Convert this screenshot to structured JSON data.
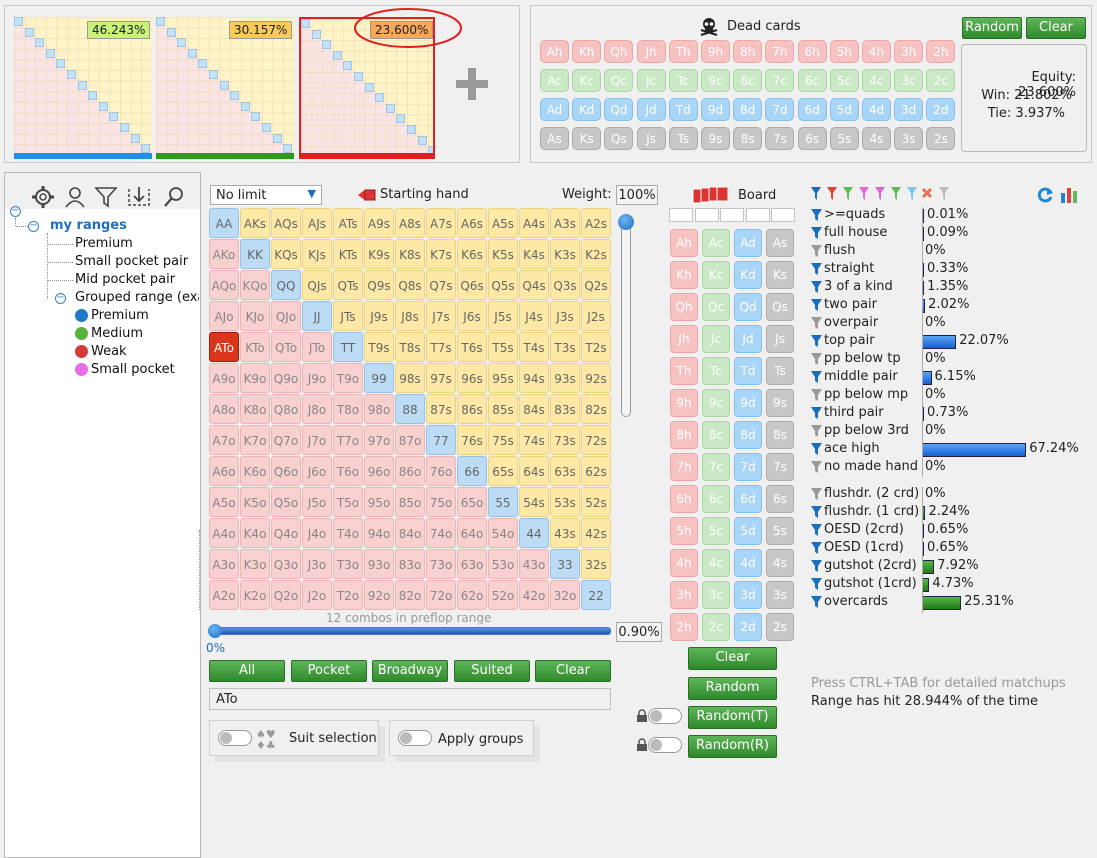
{
  "ranges_top": {
    "mini1_pct": "46.243%",
    "mini2_pct": "30.157%",
    "mini3_pct": "23.600%"
  },
  "dead_cards": {
    "title": "Dead cards",
    "rows": [
      [
        "Ah",
        "Kh",
        "Qh",
        "Jh",
        "Th",
        "9h",
        "8h",
        "7h",
        "6h",
        "5h",
        "4h",
        "3h",
        "2h"
      ],
      [
        "Ac",
        "Kc",
        "Qc",
        "Jc",
        "Tc",
        "9c",
        "8c",
        "7c",
        "6c",
        "5c",
        "4c",
        "3c",
        "2c"
      ],
      [
        "Ad",
        "Kd",
        "Qd",
        "Jd",
        "Td",
        "9d",
        "8d",
        "7d",
        "6d",
        "5d",
        "4d",
        "3d",
        "2d"
      ],
      [
        "As",
        "Ks",
        "Qs",
        "Js",
        "Ts",
        "9s",
        "8s",
        "7s",
        "6s",
        "5s",
        "4s",
        "3s",
        "2s"
      ]
    ],
    "random_label": "Random",
    "clear_label": "Clear"
  },
  "equity": {
    "equity": "Equity: 23.600%",
    "win": "Win: 21.802%",
    "tie": "Tie: 3.937%"
  },
  "tree": {
    "root": "my ranges",
    "items": [
      "Premium",
      "Small pocket pair",
      "Mid pocket pair"
    ],
    "group": "Grouped range (exar",
    "group_items": [
      "Premium",
      "Medium",
      "Weak",
      "Small pocket"
    ],
    "group_colors": [
      "#1f79c9",
      "#58b33c",
      "#d43a3a",
      "#e86be8"
    ]
  },
  "hand_panel": {
    "limit_value": "No limit",
    "starting_hand_label": "Starting hand",
    "weight_label": "Weight:",
    "weight_value": "100%",
    "grid": [
      [
        "AA",
        "AKs",
        "AQs",
        "AJs",
        "ATs",
        "A9s",
        "A8s",
        "A7s",
        "A6s",
        "A5s",
        "A4s",
        "A3s",
        "A2s"
      ],
      [
        "AKo",
        "KK",
        "KQs",
        "KJs",
        "KTs",
        "K9s",
        "K8s",
        "K7s",
        "K6s",
        "K5s",
        "K4s",
        "K3s",
        "K2s"
      ],
      [
        "AQo",
        "KQo",
        "QQ",
        "QJs",
        "QTs",
        "Q9s",
        "Q8s",
        "Q7s",
        "Q6s",
        "Q5s",
        "Q4s",
        "Q3s",
        "Q2s"
      ],
      [
        "AJo",
        "KJo",
        "QJo",
        "JJ",
        "JTs",
        "J9s",
        "J8s",
        "J7s",
        "J6s",
        "J5s",
        "J4s",
        "J3s",
        "J2s"
      ],
      [
        "ATo",
        "KTo",
        "QTo",
        "JTo",
        "TT",
        "T9s",
        "T8s",
        "T7s",
        "T6s",
        "T5s",
        "T4s",
        "T3s",
        "T2s"
      ],
      [
        "A9o",
        "K9o",
        "Q9o",
        "J9o",
        "T9o",
        "99",
        "98s",
        "97s",
        "96s",
        "95s",
        "94s",
        "93s",
        "92s"
      ],
      [
        "A8o",
        "K8o",
        "Q8o",
        "J8o",
        "T8o",
        "98o",
        "88",
        "87s",
        "86s",
        "85s",
        "84s",
        "83s",
        "82s"
      ],
      [
        "A7o",
        "K7o",
        "Q7o",
        "J7o",
        "T7o",
        "97o",
        "87o",
        "77",
        "76s",
        "75s",
        "74s",
        "73s",
        "72s"
      ],
      [
        "A6o",
        "K6o",
        "Q6o",
        "J6o",
        "T6o",
        "96o",
        "86o",
        "76o",
        "66",
        "65s",
        "64s",
        "63s",
        "62s"
      ],
      [
        "A5o",
        "K5o",
        "Q5o",
        "J5o",
        "T5o",
        "95o",
        "85o",
        "75o",
        "65o",
        "55",
        "54s",
        "53s",
        "52s"
      ],
      [
        "A4o",
        "K4o",
        "Q4o",
        "J4o",
        "T4o",
        "94o",
        "84o",
        "74o",
        "64o",
        "54o",
        "44",
        "43s",
        "42s"
      ],
      [
        "A3o",
        "K3o",
        "Q3o",
        "J3o",
        "T3o",
        "93o",
        "83o",
        "73o",
        "63o",
        "53o",
        "43o",
        "33",
        "32s"
      ],
      [
        "A2o",
        "K2o",
        "Q2o",
        "J2o",
        "T2o",
        "92o",
        "82o",
        "72o",
        "62o",
        "52o",
        "42o",
        "32o",
        "22"
      ]
    ],
    "selected": "ATo",
    "combos_text": "12 combos in preflop range",
    "slider_pct": "0.90%",
    "slider_left": "0%",
    "buttons": [
      "All",
      "Pocket",
      "Broadway",
      "Suited",
      "Clear"
    ],
    "range_text": "ATo",
    "suit_selection": "Suit selection",
    "apply_groups": "Apply groups"
  },
  "board": {
    "title": "Board",
    "ranks": [
      "A",
      "K",
      "Q",
      "J",
      "T",
      "9",
      "8",
      "7",
      "6",
      "5",
      "4",
      "3",
      "2"
    ],
    "suits": [
      "h",
      "c",
      "d",
      "s"
    ],
    "clear": "Clear",
    "random": "Random",
    "random_t": "Random(T)",
    "random_r": "Random(R)"
  },
  "stats": {
    "made": [
      {
        "label": ">=quads",
        "value": "0.01%",
        "pct": 0.01
      },
      {
        "label": "full house",
        "value": "0.09%",
        "pct": 0.09
      },
      {
        "label": "flush",
        "value": "0%",
        "pct": 0
      },
      {
        "label": "straight",
        "value": "0.33%",
        "pct": 0.33
      },
      {
        "label": "3 of a kind",
        "value": "1.35%",
        "pct": 1.35
      },
      {
        "label": "two pair",
        "value": "2.02%",
        "pct": 2.02
      },
      {
        "label": "overpair",
        "value": "0%",
        "pct": 0
      },
      {
        "label": "top pair",
        "value": "22.07%",
        "pct": 22.07
      },
      {
        "label": "pp below tp",
        "value": "0%",
        "pct": 0
      },
      {
        "label": "middle pair",
        "value": "6.15%",
        "pct": 6.15
      },
      {
        "label": "pp below mp",
        "value": "0%",
        "pct": 0
      },
      {
        "label": "third pair",
        "value": "0.73%",
        "pct": 0.73
      },
      {
        "label": "pp below 3rd",
        "value": "0%",
        "pct": 0
      },
      {
        "label": "ace high",
        "value": "67.24%",
        "pct": 67.24
      },
      {
        "label": "no made hand",
        "value": "0%",
        "pct": 0
      }
    ],
    "draws": [
      {
        "label": "flushdr. (2 crd)",
        "value": "0%",
        "pct": 0
      },
      {
        "label": "flushdr. (1 crd)",
        "value": "2.24%",
        "pct": 2.24
      },
      {
        "label": "OESD (2crd)",
        "value": "0.65%",
        "pct": 0.65
      },
      {
        "label": "OESD (1crd)",
        "value": "0.65%",
        "pct": 0.65
      },
      {
        "label": "gutshot (2crd)",
        "value": "7.92%",
        "pct": 7.92
      },
      {
        "label": "gutshot (1crd)",
        "value": "4.73%",
        "pct": 4.73
      },
      {
        "label": "overcards",
        "value": "25.31%",
        "pct": 25.31
      }
    ],
    "hint": "Press CTRL+TAB for detailed matchups",
    "range_hit": "Range has hit 28.944% of the time"
  }
}
